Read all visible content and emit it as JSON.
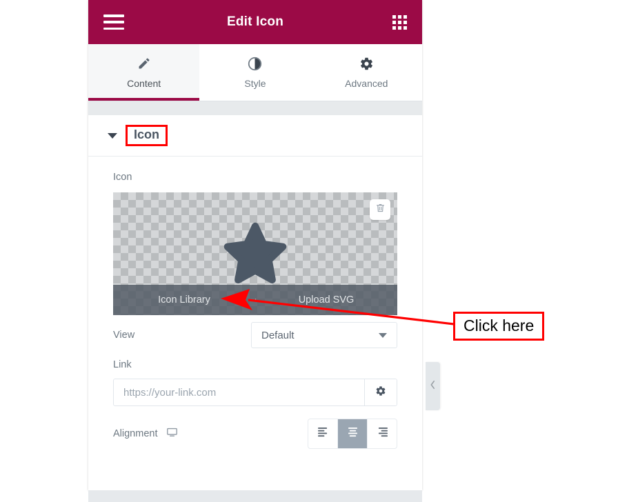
{
  "header": {
    "title": "Edit Icon",
    "menu_icon": "hamburger-icon",
    "apps_icon": "grid-icon"
  },
  "tabs": [
    {
      "label": "Content",
      "icon": "pencil-icon",
      "active": true
    },
    {
      "label": "Style",
      "icon": "contrast-icon",
      "active": false
    },
    {
      "label": "Advanced",
      "icon": "gear-icon",
      "active": false
    }
  ],
  "section": {
    "title": "Icon",
    "collapse_icon": "caret-down-icon",
    "highlighted": true
  },
  "icon_field": {
    "label": "Icon",
    "preview_icon": "star-icon",
    "delete_icon": "trash-icon",
    "actions": [
      {
        "label": "Icon Library"
      },
      {
        "label": "Upload SVG"
      }
    ]
  },
  "view_field": {
    "label": "View",
    "value": "Default",
    "dropdown_icon": "chevron-down-icon"
  },
  "link_field": {
    "label": "Link",
    "value": "",
    "placeholder": "https://your-link.com",
    "options_icon": "gear-icon"
  },
  "alignment_field": {
    "label": "Alignment",
    "device_icon": "desktop-icon",
    "options": [
      {
        "name": "align-left",
        "icon": "align-left-icon",
        "selected": false
      },
      {
        "name": "align-center",
        "icon": "align-center-icon",
        "selected": true
      },
      {
        "name": "align-right",
        "icon": "align-right-icon",
        "selected": false
      }
    ]
  },
  "collapse_handle": {
    "icon": "chevron-left-icon"
  },
  "annotation": {
    "text": "Click here",
    "box_color": "#ff0000",
    "arrow_color": "#ff0000"
  },
  "colors": {
    "header_bg": "#9b0a46",
    "active_tab_bg": "#f6f7f8",
    "star": "#4c5866",
    "preview_bar": "#4f5863",
    "panel_bg": "#ffffff",
    "page_bottom": "#e6e9ec"
  }
}
